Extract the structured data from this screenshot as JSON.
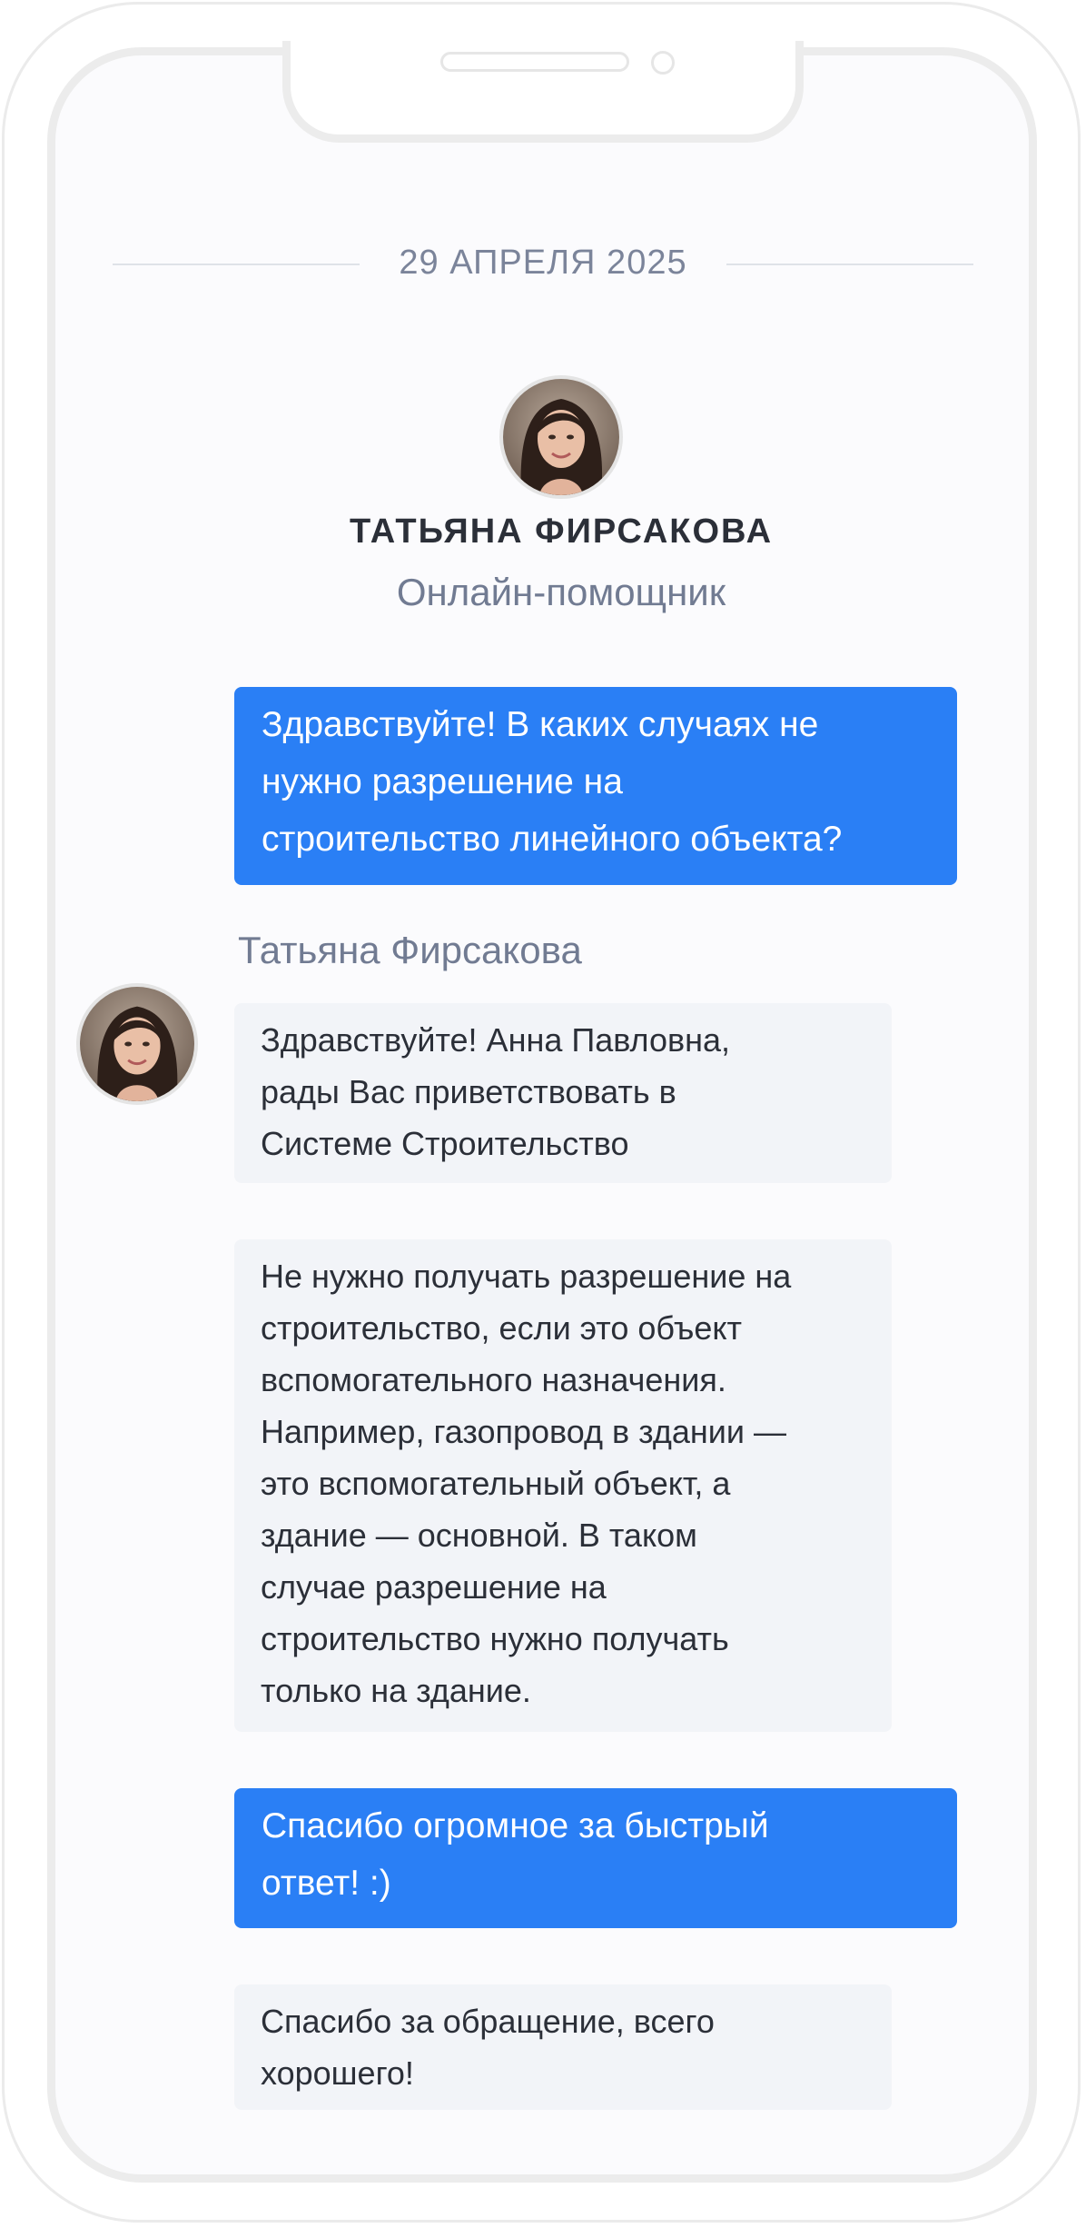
{
  "chat": {
    "date": "29 АПРЕЛЯ 2025",
    "agent": {
      "name": "ТАТЬЯНА ФИРСАКОВА",
      "role": "Онлайн-помощник"
    },
    "sender_label": "Татьяна Фирсакова",
    "messages": [
      {
        "from": "user",
        "text": "Здравствуйте! В каких случаях не\nнужно разрешение на\nстроительство линейного объекта?"
      },
      {
        "from": "agent",
        "text": "Здравствуйте! Анна Павловна,\nрады Вас приветствовать в\nСистеме Строительство"
      },
      {
        "from": "agent",
        "text": "Не нужно получать разрешение на\nстроительство, если это объект\nвспомогательного назначения.\nНапример, газопровод в здании —\nэто вспомогательный объект, а\nздание — основной. В таком\nслучае разрешение на\nстроительство нужно получать\nтолько на здание."
      },
      {
        "from": "user",
        "text": "Спасибо огромное за быстрый\nответ! :)"
      },
      {
        "from": "agent",
        "text": "Спасибо за обращение, всего\nхорошего!"
      }
    ]
  },
  "colors": {
    "user_bubble": "#2a7ff5",
    "agent_bubble": "#f2f4f8",
    "muted_text": "#717b92",
    "dark_text": "#2b2f38"
  },
  "icons": {
    "avatar": "agent-avatar-photo"
  }
}
